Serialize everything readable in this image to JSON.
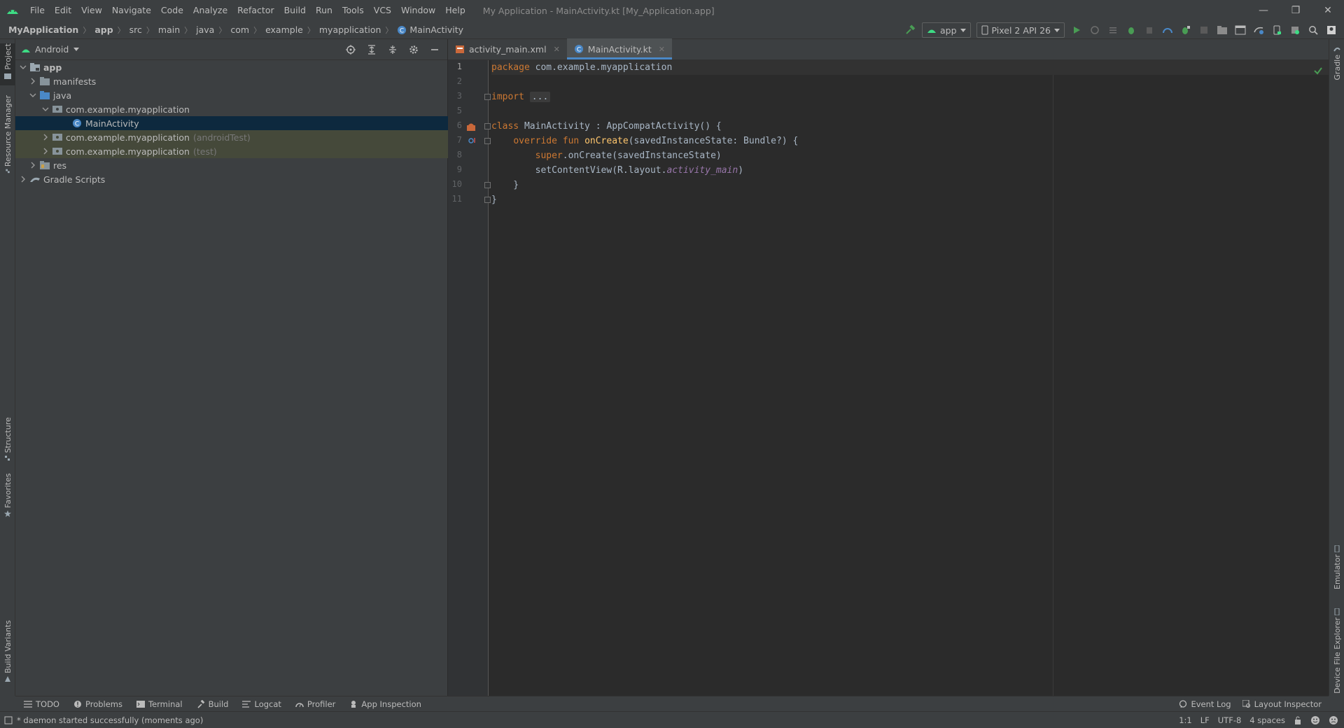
{
  "menubar": {
    "items": [
      "File",
      "Edit",
      "View",
      "Navigate",
      "Code",
      "Analyze",
      "Refactor",
      "Build",
      "Run",
      "Tools",
      "VCS",
      "Window",
      "Help"
    ],
    "window_title": "My Application - MainActivity.kt [My_Application.app]",
    "minimize": "—",
    "restore": "❐",
    "close": "✕"
  },
  "navbar": {
    "breadcrumbs": [
      "MyApplication",
      "app",
      "src",
      "main",
      "java",
      "com",
      "example",
      "myapplication",
      "MainActivity"
    ],
    "run_config": "app",
    "device": "Pixel 2 API 26"
  },
  "left_strip": {
    "project": "Project",
    "resource_manager": "Resource Manager",
    "structure": "Structure",
    "favorites": "Favorites",
    "build_variants": "Build Variants"
  },
  "right_strip": {
    "gradle": "Gradle",
    "emulator": "Emulator",
    "device_file_explorer": "Device File Explorer"
  },
  "project_panel": {
    "view_mode": "Android",
    "tree": [
      {
        "label": "app",
        "dim": ""
      },
      {
        "label": "manifests",
        "dim": ""
      },
      {
        "label": "java",
        "dim": ""
      },
      {
        "label": "com.example.myapplication",
        "dim": ""
      },
      {
        "label": "MainActivity",
        "dim": ""
      },
      {
        "label": "com.example.myapplication",
        "dim": "(androidTest)"
      },
      {
        "label": "com.example.myapplication",
        "dim": "(test)"
      },
      {
        "label": "res",
        "dim": ""
      },
      {
        "label": "Gradle Scripts",
        "dim": ""
      }
    ]
  },
  "editor": {
    "tabs": [
      {
        "label": "activity_main.xml",
        "close": "✕"
      },
      {
        "label": "MainActivity.kt",
        "close": "✕"
      }
    ],
    "line_numbers": [
      "1",
      "2",
      "3",
      "5",
      "6",
      "7",
      "8",
      "9",
      "10",
      "11"
    ],
    "code": {
      "l1_kw": "package",
      "l1_rest": " com.example.myapplication",
      "l3_kw": "import",
      "l3_fold": "...",
      "l6_kw": "class",
      "l6_rest": " MainActivity : AppCompatActivity() {",
      "l7_indent": "    ",
      "l7_kw": "override fun",
      "l7_fn": "onCreate",
      "l7_rest": "(savedInstanceState: Bundle?) {",
      "l8_indent": "        ",
      "l8_kw": "super",
      "l8_rest": ".onCreate(savedInstanceState)",
      "l9_indent": "        ",
      "l9_rest": "setContentView(R.layout.",
      "l9_it": "activity_main",
      "l9_end": ")",
      "l10": "    }",
      "l11": "}"
    }
  },
  "bottom_tools": {
    "todo": "TODO",
    "problems": "Problems",
    "terminal": "Terminal",
    "build": "Build",
    "logcat": "Logcat",
    "profiler": "Profiler",
    "app_inspection": "App Inspection",
    "event_log": "Event Log",
    "layout_inspector": "Layout Inspector"
  },
  "status": {
    "message": "* daemon started successfully (moments ago)",
    "position": "1:1",
    "line_sep": "LF",
    "encoding": "UTF-8",
    "indent": "4 spaces"
  },
  "colors": {
    "accent": "#4a88c7",
    "android_green": "#3ddc84",
    "run_green": "#499c54",
    "keyword": "#cc7832",
    "function": "#ffc66d"
  }
}
